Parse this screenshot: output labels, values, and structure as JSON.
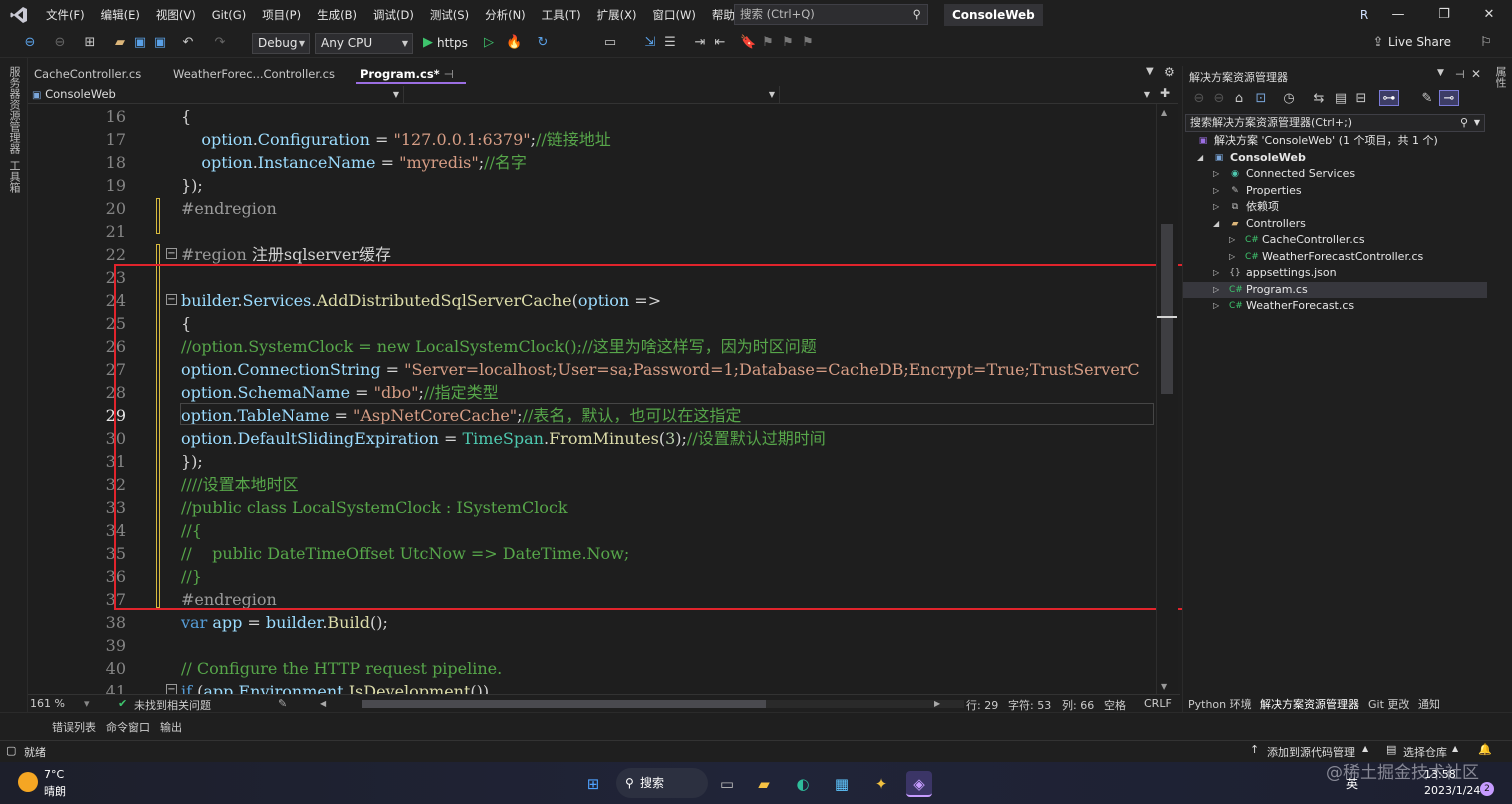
{
  "menu": {
    "items": [
      "文件(F)",
      "编辑(E)",
      "视图(V)",
      "Git(G)",
      "项目(P)",
      "生成(B)",
      "调试(D)",
      "测试(S)",
      "分析(N)",
      "工具(T)",
      "扩展(X)",
      "窗口(W)",
      "帮助(H)"
    ],
    "search_placeholder": "搜索 (Ctrl+Q)",
    "project_badge": "ConsoleWeb",
    "avatar": "R"
  },
  "toolbar": {
    "config": "Debug",
    "platform": "Any CPU",
    "run_target": "https",
    "live_share": "Live Share"
  },
  "left_strip": {
    "items": [
      "服务器资源管理器",
      "工具箱"
    ]
  },
  "tabs": [
    {
      "label": "CacheController.cs"
    },
    {
      "label": "WeatherForec...Controller.cs"
    },
    {
      "label": "Program.cs*"
    }
  ],
  "nav": {
    "project": "ConsoleWeb"
  },
  "code_lines": [
    {
      "n": "16",
      "segs": [
        [
          "pl",
          "{"
        ]
      ]
    },
    {
      "n": "17",
      "segs": [
        [
          "pl",
          "    "
        ],
        [
          "id",
          "option"
        ],
        [
          "pl",
          "."
        ],
        [
          "id",
          "Configuration"
        ],
        [
          "pl",
          " = "
        ],
        [
          "str",
          "\"127.0.0.1:6379\""
        ],
        [
          "pl",
          ";"
        ],
        [
          "cm",
          "//链接地址"
        ]
      ]
    },
    {
      "n": "18",
      "segs": [
        [
          "pl",
          "    "
        ],
        [
          "id",
          "option"
        ],
        [
          "pl",
          "."
        ],
        [
          "id",
          "InstanceName"
        ],
        [
          "pl",
          " = "
        ],
        [
          "str",
          "\"myredis\""
        ],
        [
          "pl",
          ";"
        ],
        [
          "cm",
          "//名字"
        ]
      ]
    },
    {
      "n": "19",
      "segs": [
        [
          "pl",
          "});"
        ]
      ]
    },
    {
      "n": "20",
      "segs": [
        [
          "pp",
          "#endregion"
        ]
      ]
    },
    {
      "n": "21",
      "segs": [
        [
          "pl",
          ""
        ]
      ]
    },
    {
      "n": "22",
      "segs": [
        [
          "pp",
          "#region "
        ],
        [
          "pl",
          "注册sqlserver缓存"
        ]
      ]
    },
    {
      "n": "23",
      "segs": [
        [
          "pl",
          ""
        ]
      ]
    },
    {
      "n": "24",
      "segs": [
        [
          "id",
          "builder"
        ],
        [
          "pl",
          "."
        ],
        [
          "id",
          "Services"
        ],
        [
          "pl",
          "."
        ],
        [
          "fn",
          "AddDistributedSqlServerCache"
        ],
        [
          "pl",
          "("
        ],
        [
          "id",
          "option"
        ],
        [
          "pl",
          " =>"
        ]
      ]
    },
    {
      "n": "25",
      "segs": [
        [
          "pl",
          "{"
        ]
      ]
    },
    {
      "n": "26",
      "segs": [
        [
          "cm",
          "//option.SystemClock = new LocalSystemClock();//这里为啥这样写，因为时区问题"
        ]
      ]
    },
    {
      "n": "27",
      "segs": [
        [
          "id",
          "option"
        ],
        [
          "pl",
          "."
        ],
        [
          "id",
          "ConnectionString"
        ],
        [
          "pl",
          " = "
        ],
        [
          "str",
          "\"Server=localhost;User=sa;Password=1;Database=CacheDB;Encrypt=True;TrustServerC"
        ]
      ]
    },
    {
      "n": "28",
      "segs": [
        [
          "id",
          "option"
        ],
        [
          "pl",
          "."
        ],
        [
          "id",
          "SchemaName"
        ],
        [
          "pl",
          " = "
        ],
        [
          "str",
          "\"dbo\""
        ],
        [
          "pl",
          ";"
        ],
        [
          "cm",
          "//指定类型"
        ]
      ]
    },
    {
      "n": "29",
      "segs": [
        [
          "id",
          "option"
        ],
        [
          "pl",
          "."
        ],
        [
          "id",
          "TableName"
        ],
        [
          "pl",
          " = "
        ],
        [
          "str",
          "\"AspNetCoreCache\""
        ],
        [
          "pl",
          ";"
        ],
        [
          "cm",
          "//表名，默认，也可以在这指定"
        ]
      ]
    },
    {
      "n": "30",
      "segs": [
        [
          "id",
          "option"
        ],
        [
          "pl",
          "."
        ],
        [
          "id",
          "DefaultSlidingExpiration"
        ],
        [
          "pl",
          " = "
        ],
        [
          "ty",
          "TimeSpan"
        ],
        [
          "pl",
          "."
        ],
        [
          "fn",
          "FromMinutes"
        ],
        [
          "pl",
          "("
        ],
        [
          "num",
          "3"
        ],
        [
          "pl",
          ");"
        ],
        [
          "cm",
          "//设置默认过期时间"
        ]
      ]
    },
    {
      "n": "31",
      "segs": [
        [
          "pl",
          "});"
        ]
      ]
    },
    {
      "n": "32",
      "segs": [
        [
          "cm",
          "////设置本地时区"
        ]
      ]
    },
    {
      "n": "33",
      "segs": [
        [
          "cm",
          "//public class LocalSystemClock : ISystemClock"
        ]
      ]
    },
    {
      "n": "34",
      "segs": [
        [
          "cm",
          "//{"
        ]
      ]
    },
    {
      "n": "35",
      "segs": [
        [
          "cm",
          "//    public DateTimeOffset UtcNow => DateTime.Now;"
        ]
      ]
    },
    {
      "n": "36",
      "segs": [
        [
          "cm",
          "//}"
        ]
      ]
    },
    {
      "n": "37",
      "segs": [
        [
          "pp",
          "#endregion"
        ]
      ]
    },
    {
      "n": "38",
      "segs": [
        [
          "kw",
          "var "
        ],
        [
          "id",
          "app"
        ],
        [
          "pl",
          " = "
        ],
        [
          "id",
          "builder"
        ],
        [
          "pl",
          "."
        ],
        [
          "fn",
          "Build"
        ],
        [
          "pl",
          "();"
        ]
      ]
    },
    {
      "n": "39",
      "segs": [
        [
          "pl",
          ""
        ]
      ]
    },
    {
      "n": "40",
      "segs": [
        [
          "cm",
          "// Configure the HTTP request pipeline."
        ]
      ]
    },
    {
      "n": "41",
      "segs": [
        [
          "kw",
          "if "
        ],
        [
          "pl",
          "("
        ],
        [
          "id",
          "app"
        ],
        [
          "pl",
          "."
        ],
        [
          "id",
          "Environment"
        ],
        [
          "pl",
          "."
        ],
        [
          "fn",
          "IsDevelopment"
        ],
        [
          "pl",
          "())"
        ]
      ]
    }
  ],
  "status_line": {
    "zoom": "161 %",
    "issues": "未找到相关问题",
    "row": "行: 29",
    "char": "字符: 53",
    "col": "列: 66",
    "spaces": "空格",
    "eol": "CRLF"
  },
  "solution_explorer": {
    "title": "解决方案资源管理器",
    "search_placeholder": "搜索解决方案资源管理器(Ctrl+;)",
    "items": [
      {
        "label": "解决方案 'ConsoleWeb' (1 个项目，共 1 个)",
        "icon": "solution-icon"
      },
      {
        "label": "ConsoleWeb",
        "icon": "project-icon"
      },
      {
        "label": "Connected Services",
        "icon": "connected-services-icon"
      },
      {
        "label": "Properties",
        "icon": "wrench-icon"
      },
      {
        "label": "依赖项",
        "icon": "dependencies-icon"
      },
      {
        "label": "Controllers",
        "icon": "folder-icon"
      },
      {
        "label": "CacheController.cs",
        "icon": "csharp-file-icon"
      },
      {
        "label": "WeatherForecastController.cs",
        "icon": "csharp-file-icon"
      },
      {
        "label": "appsettings.json",
        "icon": "json-file-icon"
      },
      {
        "label": "Program.cs",
        "icon": "csharp-file-icon"
      },
      {
        "label": "WeatherForecast.cs",
        "icon": "csharp-file-icon"
      }
    ],
    "bottom_tabs": [
      "Python 环境",
      "解决方案资源管理器",
      "Git 更改",
      "通知"
    ]
  },
  "bottom_tabs": [
    "错误列表",
    "命令窗口",
    "输出"
  ],
  "statusbar": {
    "ready": "就绪",
    "add_source": "添加到源代码管理",
    "select_repo": "选择仓库"
  },
  "taskbar": {
    "temp": "7°C",
    "weather": "晴朗",
    "search": "搜索",
    "ime": "英",
    "time": "13:58",
    "date": "2023/1/24",
    "notifications": "2"
  },
  "watermark": "@稀土掘金技术社区",
  "colors": {
    "accent": "#9b6ee2",
    "highlight_box": "#e0242c",
    "caret_yellow": "#d7ba3e"
  }
}
